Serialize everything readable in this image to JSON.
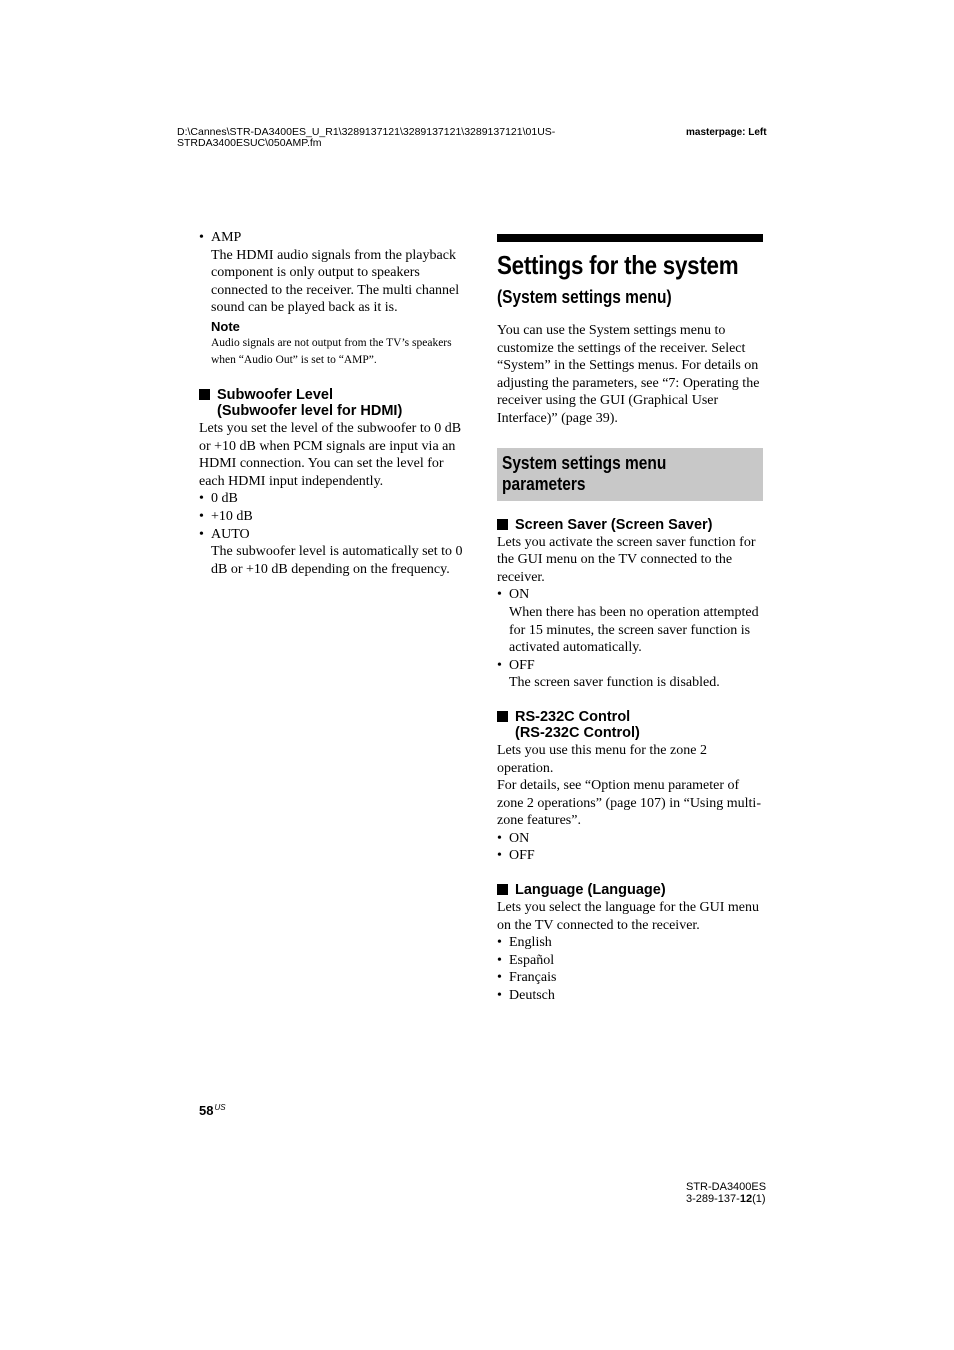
{
  "header": {
    "file_path_line1": "D:\\Cannes\\STR-DA3400ES_U_R1\\3289137121\\3289137121\\3289137121\\01US-",
    "file_path_line2": "STRDA3400ESUC\\050AMP.fm",
    "masterpage": "masterpage: Left"
  },
  "left_column": {
    "amp_bullet": {
      "label": "AMP",
      "description": "The HDMI audio signals from the playback component is only output to speakers connected to the receiver. The multi channel sound can be played back as it is."
    },
    "note": {
      "title": "Note",
      "text": "Audio signals are not output from the TV’s speakers when “Audio Out” is set to “AMP”."
    },
    "subwoofer_section": {
      "heading_line1": "Subwoofer Level",
      "heading_line2": "(Subwoofer level for HDMI)",
      "description": "Lets you set the level of the subwoofer to 0 dB or +10 dB when PCM signals are input via an HDMI connection. You can set the level for each HDMI input independently.",
      "options": [
        {
          "label": "0 dB",
          "description": ""
        },
        {
          "label": "+10 dB",
          "description": ""
        },
        {
          "label": "AUTO",
          "description": "The subwoofer level is automatically set to 0 dB or +10 dB depending on the frequency."
        }
      ]
    }
  },
  "right_column": {
    "title": "Settings for the system",
    "subtitle": "(System settings menu)",
    "intro": "You can use the System settings menu to customize the settings of the receiver. Select “System” in the Settings menus. For details on adjusting the parameters, see “7: Operating the receiver using the GUI (Graphical User Interface)” (page 39).",
    "params_box_line1": "System settings menu",
    "params_box_line2": "parameters",
    "screen_saver": {
      "heading": "Screen Saver (Screen Saver)",
      "description": "Lets you activate the screen saver function for the GUI menu on the TV connected to the receiver.",
      "options": [
        {
          "label": "ON",
          "description": "When there has been no operation attempted for 15 minutes, the screen saver function is activated automatically."
        },
        {
          "label": "OFF",
          "description": "The screen saver function is disabled."
        }
      ]
    },
    "rs232c": {
      "heading_line1": "RS-232C Control",
      "heading_line2": "(RS-232C Control)",
      "description1": "Lets you use this menu for the zone 2 operation.",
      "description2": "For details, see “Option menu parameter of zone 2 operations” (page 107) in “Using multi-zone features”.",
      "options": [
        "ON",
        "OFF"
      ]
    },
    "language": {
      "heading": "Language (Language)",
      "description": "Lets you select the language for the GUI menu on the TV connected to the receiver.",
      "options": [
        "English",
        "Español",
        "Français",
        "Deutsch"
      ]
    }
  },
  "footer": {
    "page_number": "58",
    "page_suffix": "US",
    "model": "STR-DA3400ES",
    "code_prefix": "3-289-137-",
    "code_bold": "12",
    "code_suffix": "(1)"
  },
  "bullet_char": "•"
}
